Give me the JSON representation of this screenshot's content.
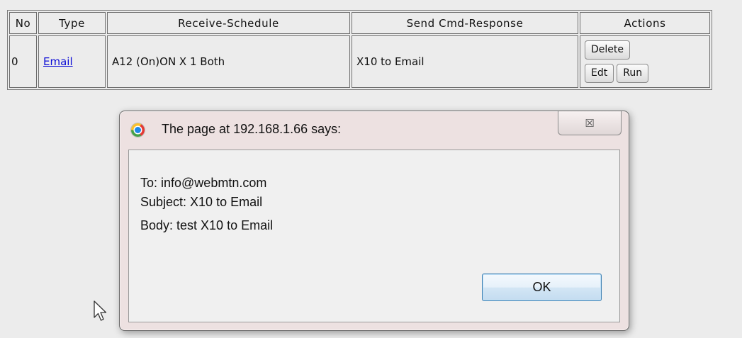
{
  "table": {
    "headers": {
      "no": "No",
      "type": "Type",
      "receive_schedule": "Receive-Schedule",
      "send_cmd_response": "Send Cmd-Response",
      "actions": "Actions"
    },
    "rows": [
      {
        "no": "0",
        "type": "Email",
        "receive_schedule": "A12 (On)ON X 1 Both",
        "send_cmd_response": "X10 to Email",
        "delete_label": "Delete",
        "edit_label": "Edt",
        "run_label": "Run"
      }
    ]
  },
  "dialog": {
    "title": "The page at 192.168.1.66 says:",
    "close_glyph": "☒",
    "icon": "chrome-icon",
    "lines": [
      "To: info@webmtn.com",
      "Subject: X10 to Email",
      "Body: test X10 to Email"
    ],
    "ok_label": "OK"
  },
  "cursor": "mouse-pointer-icon"
}
